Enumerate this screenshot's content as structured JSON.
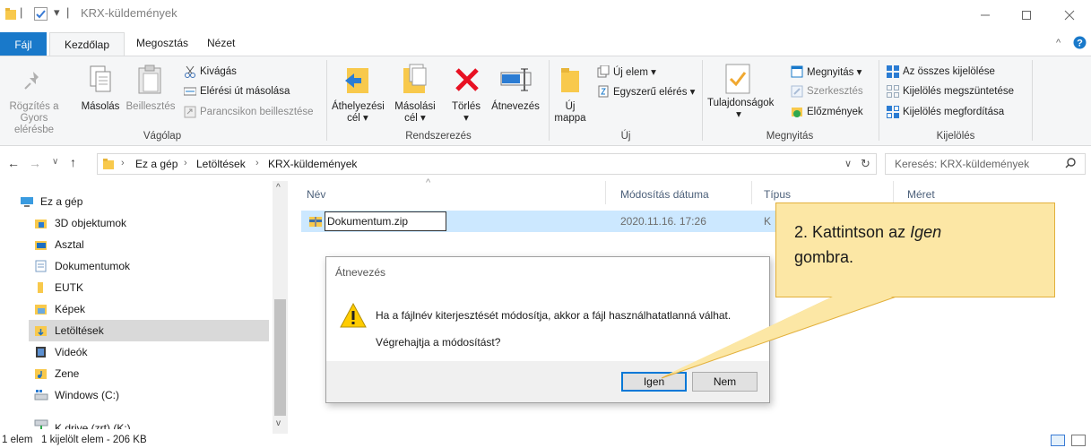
{
  "window": {
    "title": "KRX-küldemények",
    "quick_access_sep": "|",
    "dropdown_glyph": "▾"
  },
  "tabs": [
    "Fájl",
    "Kezdőlap",
    "Megosztás",
    "Nézet"
  ],
  "ribbon": {
    "clipboard": {
      "pin_label": "Rögzítés a Gyors elérésbe",
      "copy_label": "Másolás",
      "paste_label": "Beillesztés",
      "cut": "Kivágás",
      "copy_path": "Elérési út másolása",
      "paste_shortcut": "Parancsikon beillesztése",
      "group": "Vágólap"
    },
    "organize": {
      "move_to": "Áthelyezési cél ▾",
      "copy_to": "Másolási cél ▾",
      "delete": "Törlés",
      "rename": "Átnevezés",
      "group": "Rendszerezés"
    },
    "new": {
      "new_folder": "Új mappa",
      "new_item": "Új elem ▾",
      "easy_access": "Egyszerű elérés ▾",
      "group": "Új"
    },
    "open": {
      "properties": "Tulajdonságok",
      "open": "Megnyitás ▾",
      "edit": "Szerkesztés",
      "history": "Előzmények",
      "group": "Megnyitás"
    },
    "select": {
      "select_all": "Az összes kijelölése",
      "select_none": "Kijelölés megszüntetése",
      "invert": "Kijelölés megfordítása",
      "group": "Kijelölés"
    }
  },
  "address": {
    "crumbs": [
      "Ez a gép",
      "Letöltések",
      "KRX-küldemények"
    ],
    "search_placeholder": "Keresés: KRX-küldemények"
  },
  "nav": {
    "items": [
      "Ez a gép",
      "3D objektumok",
      "Asztal",
      "Dokumentumok",
      "EUTK",
      "Képek",
      "Letöltések",
      "Videók",
      "Zene",
      "Windows (C:)",
      "K drive (zrt) (K:)"
    ]
  },
  "filelist": {
    "columns": [
      "Név",
      "Módosítás dátuma",
      "Típus",
      "Méret"
    ],
    "rows": [
      {
        "name": "Dokumentum.zip",
        "date": "2020.11.16. 17:26",
        "type": "K"
      }
    ]
  },
  "statusbar": {
    "items": "1 elem",
    "selected": "1 kijelölt elem - 206 KB"
  },
  "dialog": {
    "title": "Átnevezés",
    "message": "Ha a fájlnév kiterjesztését módosítja, akkor a fájl használhatatlanná válhat.",
    "question": "Végrehajtja a módosítást?",
    "yes": "Igen",
    "no": "Nem"
  },
  "callout": {
    "prefix": "2. Kattintson az ",
    "emph": "Igen",
    "suffix": "gombra."
  },
  "colors": {
    "accent": "#1979ca",
    "selection": "#cce8ff",
    "callout_fill": "#fce7a5",
    "callout_border": "#e2b03c",
    "delete_red": "#e81123",
    "folder_yellow": "#f8c94c"
  }
}
